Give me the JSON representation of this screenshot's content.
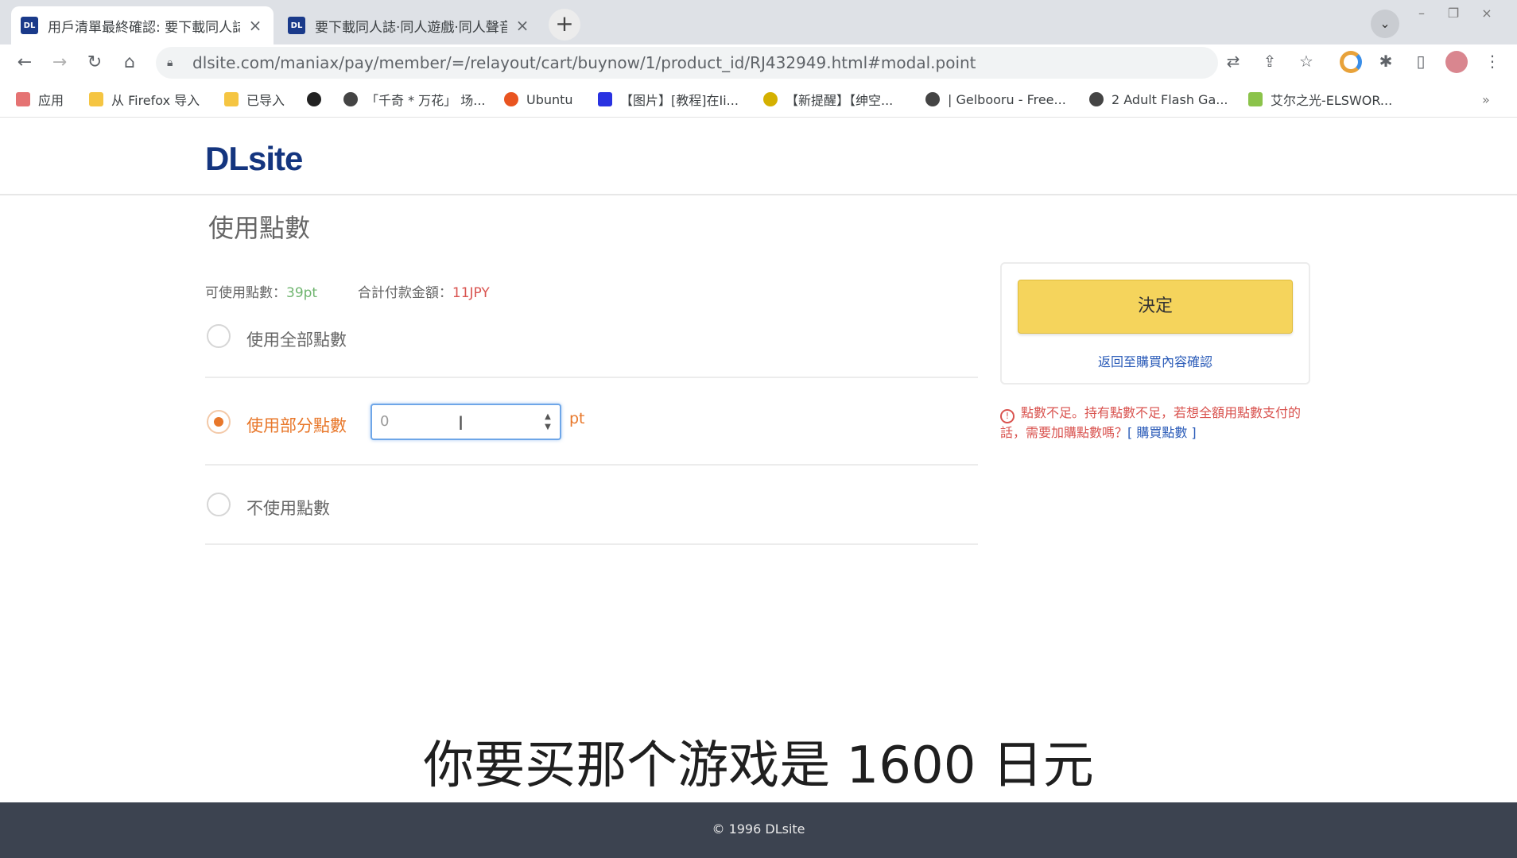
{
  "browser": {
    "tabs": [
      {
        "favicon": "DL",
        "title": "用戶清單最終確認: 要下載同人誌…",
        "active": true
      },
      {
        "favicon": "DL",
        "title": "要下載同人誌·同人遊戲·同人聲音…",
        "active": false
      }
    ],
    "url": "dlsite.com/maniax/pay/member/=/relayout/cart/buynow/1/product_id/RJ432949.html#modal.point",
    "bookmarks": [
      "应用",
      "从 Firefox 导入",
      "已导入",
      "「千奇 * 万花」 场...",
      "Ubuntu",
      "【图片】[教程]在Ii...",
      "【新提醒】【绅空...",
      "| Gelbooru - Free...",
      "2 Adult Flash Ga...",
      "艾尔之光-ELSWOR..."
    ]
  },
  "site": {
    "logo": "DLsite"
  },
  "points": {
    "title": "使用點數",
    "available_label": "可使用點數：",
    "available_value": "39pt",
    "total_label": "合計付款金額：",
    "total_value": "11JPY",
    "options": [
      {
        "label": "使用全部點數",
        "selected": false
      },
      {
        "label": "使用部分點數",
        "selected": true
      },
      {
        "label": "不使用點數",
        "selected": false
      }
    ],
    "partial_value": "0",
    "unit": "pt"
  },
  "side": {
    "decide_label": "決定",
    "back_link": "返回至購買內容確認",
    "warning_text": "點數不足。持有點數不足，若想全額用點數支付的話，需要加購點數嗎？",
    "warning_buy": "[ 購買點數 ]"
  },
  "subtitle": "你要买那个游戏是 1600 日元",
  "footer": "© 1996 DLsite",
  "colors": {
    "accent_orange": "#e8772a",
    "button_yellow": "#f5d45c",
    "logo_blue": "#14357f",
    "warning_red": "#d9534f",
    "footer_bg": "#3c4350"
  }
}
